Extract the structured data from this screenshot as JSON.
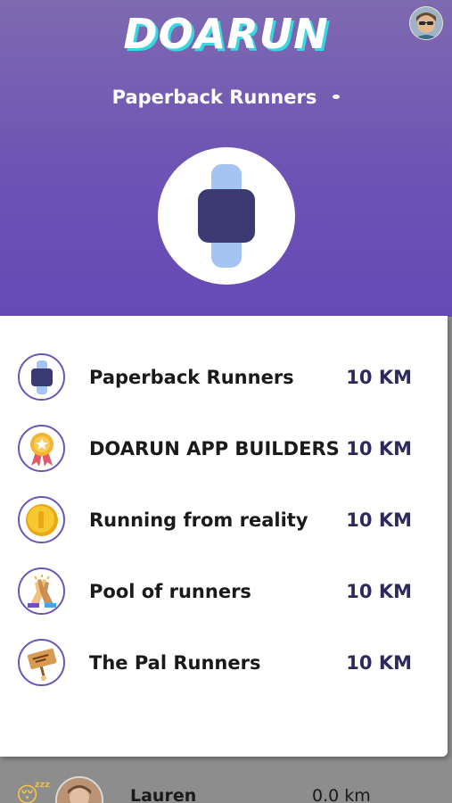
{
  "app": {
    "logo": "DOARUN"
  },
  "header": {
    "selected_group": "Paperback Runners",
    "hero_icon": "smartwatch-icon",
    "avatar": "user-avatar"
  },
  "dropdown": {
    "items": [
      {
        "name": "Paperback Runners",
        "distance": "10 KM",
        "icon": "smartwatch-icon"
      },
      {
        "name": "DOARUN APP BUILDERS",
        "distance": "10 KM",
        "icon": "medal-icon"
      },
      {
        "name": "Running from reality",
        "distance": "10 KM",
        "icon": "coin-icon"
      },
      {
        "name": "Pool of runners",
        "distance": "10 KM",
        "icon": "high-five-icon"
      },
      {
        "name": "The Pal Runners",
        "distance": "10 KM",
        "icon": "you-can-do-it-sign-icon"
      }
    ]
  },
  "background_list": {
    "row": {
      "status_icon": "sleeping-face-icon",
      "name": "Lauren",
      "distance": "0.0 km"
    }
  },
  "colors": {
    "header_top": "#7e6ab1",
    "header_bottom": "#6649b6",
    "logo_shadow": "#37d7df",
    "icon_border": "#6d55b7",
    "distance_text": "#2c2960",
    "watch_band": "#a4c4f1",
    "watch_face": "#3c3a72"
  }
}
